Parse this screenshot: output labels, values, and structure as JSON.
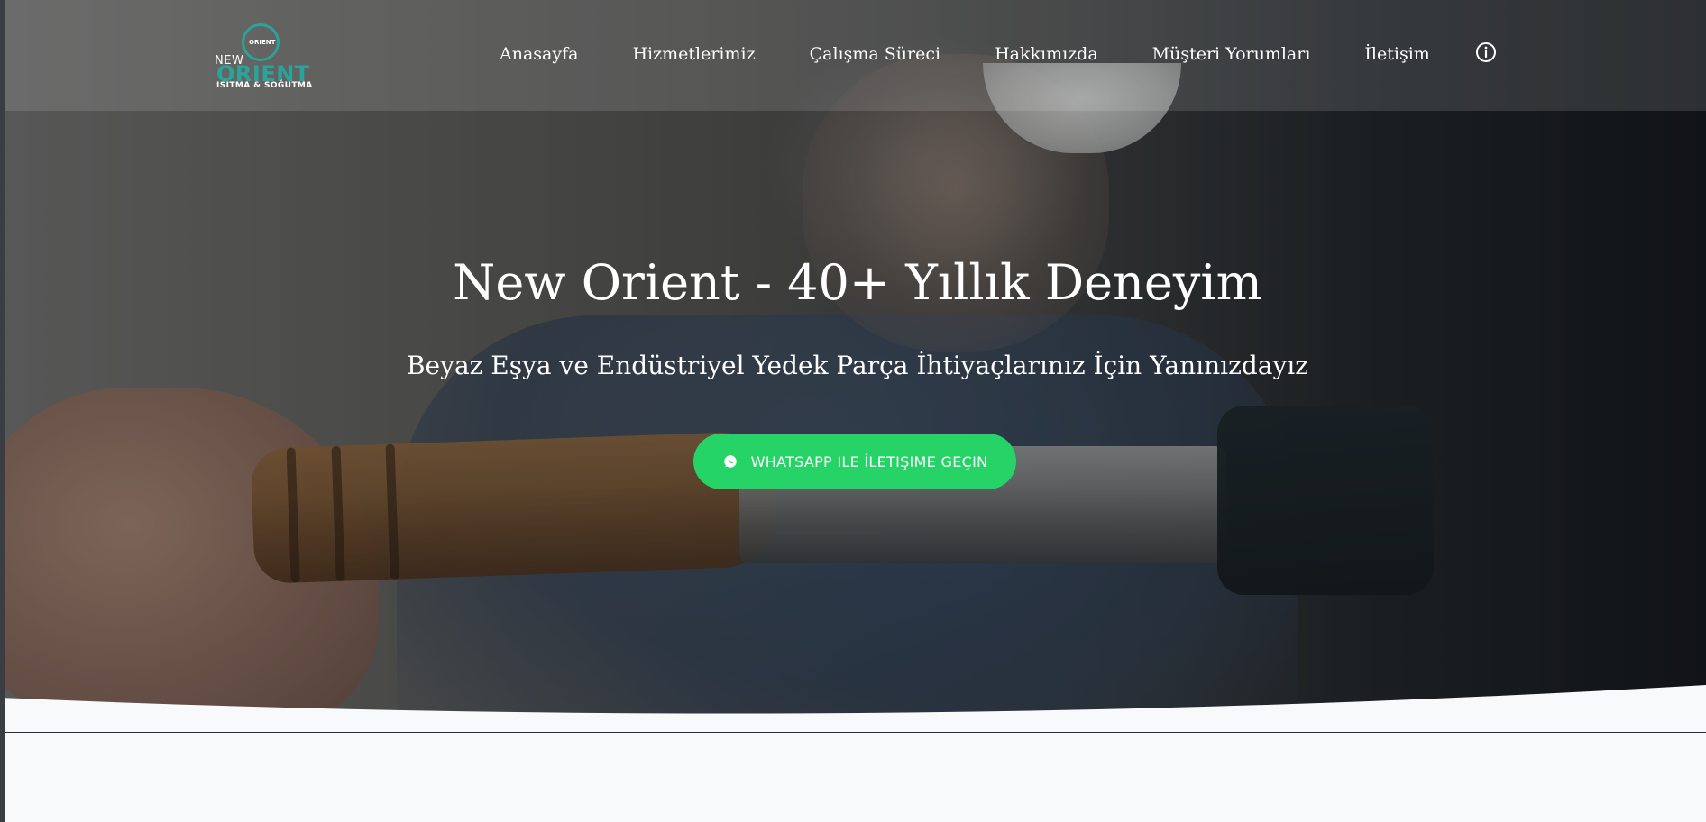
{
  "header": {
    "logo": {
      "small_text": "ORIENT",
      "word_new": "NEW",
      "word_main": "ORIENT",
      "tagline": "ISITMA & SOĞUTMA"
    },
    "nav": [
      {
        "label": "Anasayfa"
      },
      {
        "label": "Hizmetlerimiz"
      },
      {
        "label": "Çalışma Süreci"
      },
      {
        "label": "Hakkımızda"
      },
      {
        "label": "Müşteri Yorumları"
      },
      {
        "label": "İletişim"
      }
    ],
    "info_icon": "info-circle-icon"
  },
  "hero": {
    "title": "New Orient - 40+ Yıllık Deneyim",
    "subtitle": "Beyaz Eşya ve Endüstriyel Yedek Parça İhtiyaçlarınız İçin Yanınızdayız",
    "cta": {
      "label": "WHATSAPP ILE İLETIŞIME GEÇIN",
      "icon": "whatsapp-icon",
      "color": "#25d366"
    }
  },
  "colors": {
    "brand_teal": "#2aa39a",
    "cta_green": "#25d366",
    "page_bg": "#f8f9fb"
  }
}
